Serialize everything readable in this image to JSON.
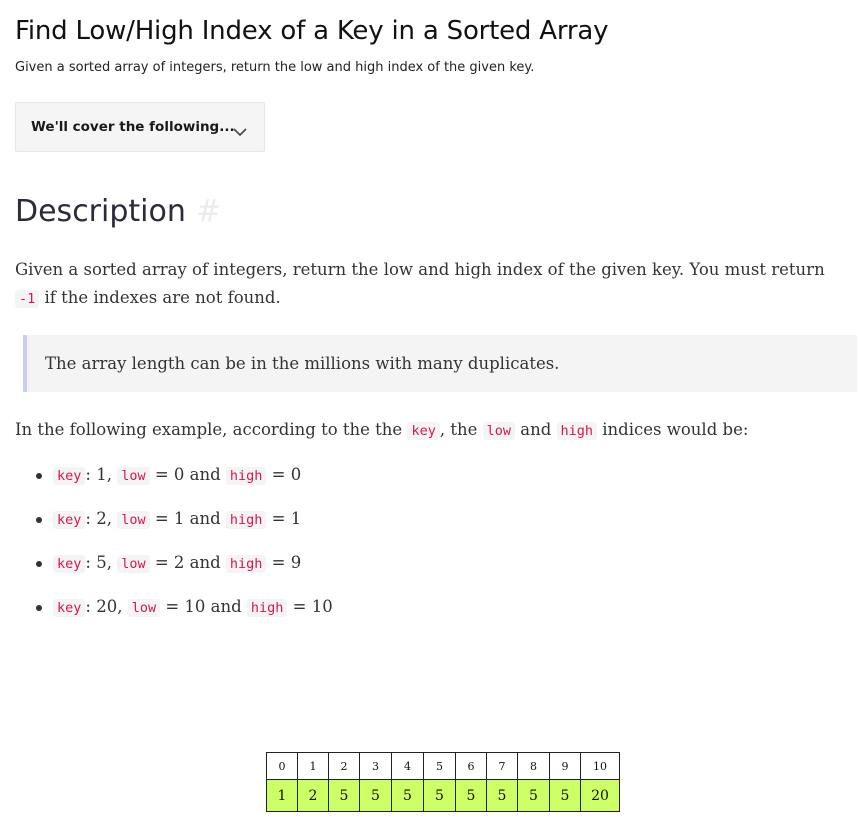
{
  "page": {
    "title": "Find Low/High Index of a Key in a Sorted Array",
    "subtitle": "Given a sorted array of integers, return the low and high index of the given key."
  },
  "toc": {
    "label": "We'll cover the following...",
    "icon": "chevron-down-icon"
  },
  "description": {
    "heading": "Description",
    "anchor": "#",
    "paragraph": {
      "before": "Given a sorted array of integers, return the low and high index of the given key. You must return ",
      "code": "-1",
      "after": " if the indexes are not found."
    },
    "note": "The array length can be in the millions with many duplicates.",
    "example_intro": {
      "t1": "In the following example, according to the the ",
      "c1": "key",
      "t2": ", the ",
      "c2": "low",
      "t3": " and ",
      "c3": "high",
      "t4": " indices would be:"
    },
    "bullets": [
      {
        "k": "key",
        "kv": ": 1, ",
        "l": "low",
        "lv": " = 0 and ",
        "h": "high",
        "hv": " = 0"
      },
      {
        "k": "key",
        "kv": ": 2, ",
        "l": "low",
        "lv": " = 1 and ",
        "h": "high",
        "hv": " = 1"
      },
      {
        "k": "key",
        "kv": ": 5, ",
        "l": "low",
        "lv": " = 2 and ",
        "h": "high",
        "hv": " = 9"
      },
      {
        "k": "key",
        "kv": ": 20, ",
        "l": "low",
        "lv": " = 10 and ",
        "h": "high",
        "hv": " = 10"
      }
    ]
  },
  "array": {
    "indices": [
      "0",
      "1",
      "2",
      "3",
      "4",
      "5",
      "6",
      "7",
      "8",
      "9",
      "10"
    ],
    "values": [
      "1",
      "2",
      "5",
      "5",
      "5",
      "5",
      "5",
      "5",
      "5",
      "5",
      "20"
    ],
    "value_cell_color": "#ccff66"
  }
}
